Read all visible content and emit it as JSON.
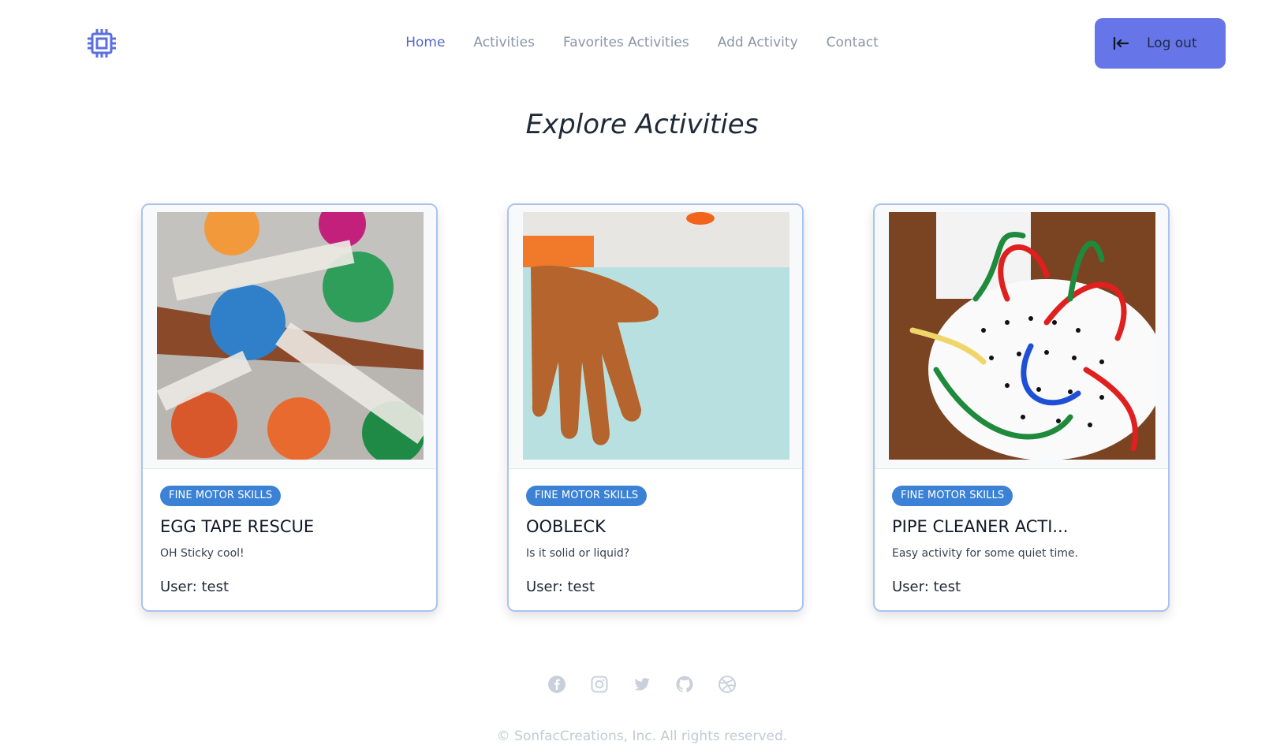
{
  "header": {
    "logo_icon": "cpu-chip-icon",
    "nav": [
      {
        "label": "Home",
        "active": true
      },
      {
        "label": "Activities"
      },
      {
        "label": "Favorites Activities"
      },
      {
        "label": "Add Activity"
      },
      {
        "label": "Contact"
      }
    ],
    "logout_label": "Log out",
    "logout_icon": "logout-arrow-icon"
  },
  "page": {
    "title": "Explore Activities"
  },
  "cards": [
    {
      "category": "FINE MOTOR SKILLS",
      "title": "EGG TAPE RESCUE",
      "description": "OH Sticky cool!",
      "user": "User: test"
    },
    {
      "category": "FINE MOTOR SKILLS",
      "title": "OOBLECK",
      "description": "Is it solid or liquid?",
      "user": "User: test"
    },
    {
      "category": "FINE MOTOR SKILLS",
      "title": "PIPE CLEANER ACTI...",
      "description": "Easy activity for some quiet time.",
      "user": "User: test"
    }
  ],
  "footer": {
    "social_icons": [
      "facebook-icon",
      "instagram-icon",
      "twitter-icon",
      "github-icon",
      "dribbble-icon"
    ],
    "copyright": "© SonfacCreations, Inc. All rights reserved."
  },
  "colors": {
    "accent": "#6675e8",
    "nav_active": "#5567c9",
    "badge": "#3b82d6",
    "card_border": "#a9c4f0"
  }
}
